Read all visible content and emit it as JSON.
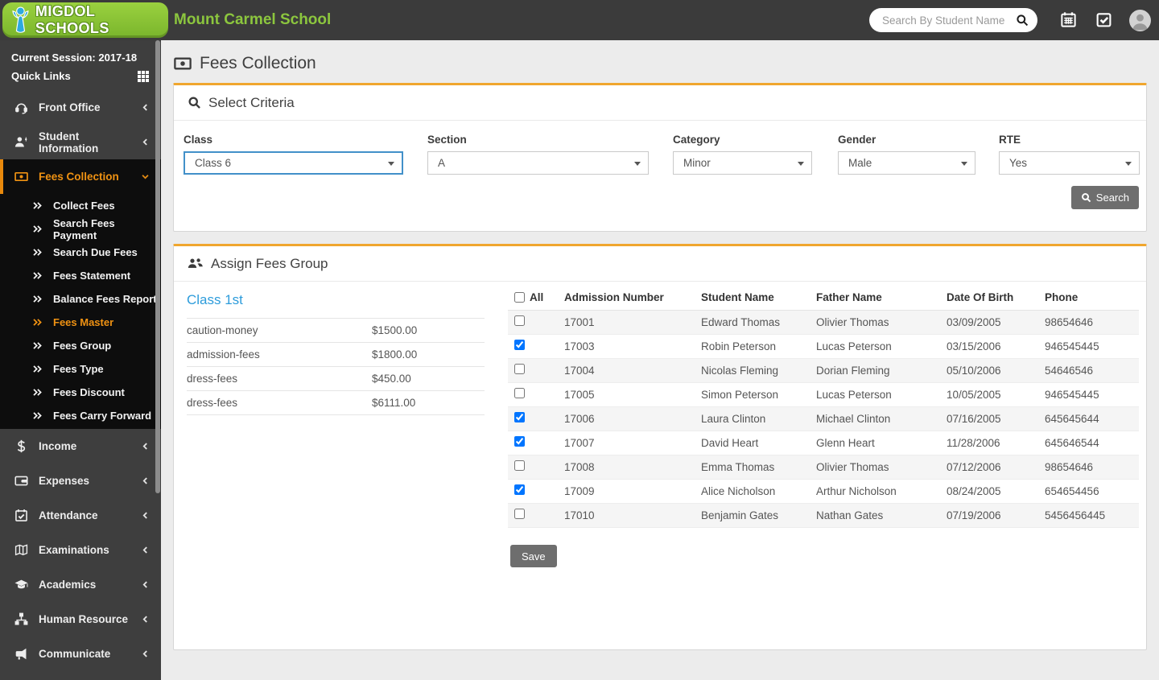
{
  "colors": {
    "accent_orange": "#ef9213",
    "panel_top_orange": "#f0a62e",
    "brand_green": "#8cc63e",
    "focus_blue": "#4290c9",
    "link_blue": "#2d9cdb",
    "button_gray": "#6e6e6e"
  },
  "header": {
    "logo_text": "MIGDOL SCHOOLS",
    "school_name": "Mount Carmel School",
    "search_placeholder": "Search By Student Name",
    "icons": [
      "search-icon",
      "calendar-icon",
      "task-check-icon",
      "user-avatar"
    ]
  },
  "sidebar": {
    "session_label": "Current Session: 2017-18",
    "quick_links_label": "Quick Links",
    "quick_links_icon": "grid-icon",
    "items": [
      {
        "label": "Front Office",
        "icon": "front-office-icon",
        "chevron": "left",
        "active": false
      },
      {
        "label": "Student Information",
        "icon": "student-info-icon",
        "chevron": "left",
        "active": false
      },
      {
        "label": "Fees Collection",
        "icon": "fees-icon",
        "chevron": "down",
        "active": true,
        "children": [
          "Collect Fees",
          "Search Fees Payment",
          "Search Due Fees",
          "Fees Statement",
          "Balance Fees Report",
          "Fees Master",
          "Fees Group",
          "Fees Type",
          "Fees Discount",
          "Fees Carry Forward"
        ],
        "active_child": "Fees Master"
      },
      {
        "label": "Income",
        "icon": "income-icon",
        "chevron": "left",
        "active": false
      },
      {
        "label": "Expenses",
        "icon": "expenses-icon",
        "chevron": "left",
        "active": false
      },
      {
        "label": "Attendance",
        "icon": "attendance-icon",
        "chevron": "left",
        "active": false
      },
      {
        "label": "Examinations",
        "icon": "examinations-icon",
        "chevron": "left",
        "active": false
      },
      {
        "label": "Academics",
        "icon": "academics-icon",
        "chevron": "left",
        "active": false
      },
      {
        "label": "Human Resource",
        "icon": "hr-icon",
        "chevron": "left",
        "active": false
      },
      {
        "label": "Communicate",
        "icon": "communicate-icon",
        "chevron": "left",
        "active": false
      }
    ]
  },
  "page": {
    "title": "Fees Collection",
    "title_icon": "money-bill-icon"
  },
  "criteria": {
    "title": "Select Criteria",
    "title_icon": "search-icon",
    "fields": [
      {
        "label": "Class",
        "value": "Class 6",
        "focused": true
      },
      {
        "label": "Section",
        "value": "A",
        "focused": false
      },
      {
        "label": "Category",
        "value": "Minor",
        "focused": false
      },
      {
        "label": "Gender",
        "value": "Male",
        "focused": false
      },
      {
        "label": "RTE",
        "value": "Yes",
        "focused": false
      }
    ],
    "search_button": "Search"
  },
  "assign": {
    "title": "Assign Fees Group",
    "title_icon": "users-icon",
    "group_name": "Class 1st",
    "fees": [
      {
        "name": "caution-money",
        "amount": "$1500.00"
      },
      {
        "name": "admission-fees",
        "amount": "$1800.00"
      },
      {
        "name": "dress-fees",
        "amount": "$450.00"
      },
      {
        "name": "dress-fees",
        "amount": "$6111.00"
      }
    ],
    "table": {
      "select_all_label": "All",
      "columns": [
        "Admission Number",
        "Student Name",
        "Father Name",
        "Date Of Birth",
        "Phone"
      ],
      "rows": [
        {
          "checked": false,
          "admission": "17001",
          "student": "Edward Thomas",
          "father": "Olivier Thomas",
          "dob": "03/09/2005",
          "phone": "98654646"
        },
        {
          "checked": true,
          "admission": "17003",
          "student": "Robin Peterson",
          "father": "Lucas Peterson",
          "dob": "03/15/2006",
          "phone": "946545445"
        },
        {
          "checked": false,
          "admission": "17004",
          "student": "Nicolas Fleming",
          "father": "Dorian Fleming",
          "dob": "05/10/2006",
          "phone": "54646546"
        },
        {
          "checked": false,
          "admission": "17005",
          "student": "Simon Peterson",
          "father": "Lucas Peterson",
          "dob": "10/05/2005",
          "phone": "946545445"
        },
        {
          "checked": true,
          "admission": "17006",
          "student": "Laura Clinton",
          "father": "Michael Clinton",
          "dob": "07/16/2005",
          "phone": "645645644"
        },
        {
          "checked": true,
          "admission": "17007",
          "student": "David Heart",
          "father": "Glenn Heart",
          "dob": "11/28/2006",
          "phone": "645646544"
        },
        {
          "checked": false,
          "admission": "17008",
          "student": "Emma Thomas",
          "father": "Olivier Thomas",
          "dob": "07/12/2006",
          "phone": "98654646"
        },
        {
          "checked": true,
          "admission": "17009",
          "student": "Alice Nicholson",
          "father": "Arthur Nicholson",
          "dob": "08/24/2005",
          "phone": "654654456"
        },
        {
          "checked": false,
          "admission": "17010",
          "student": "Benjamin Gates",
          "father": "Nathan Gates",
          "dob": "07/19/2006",
          "phone": "5456456445"
        }
      ]
    },
    "save_button": "Save"
  }
}
